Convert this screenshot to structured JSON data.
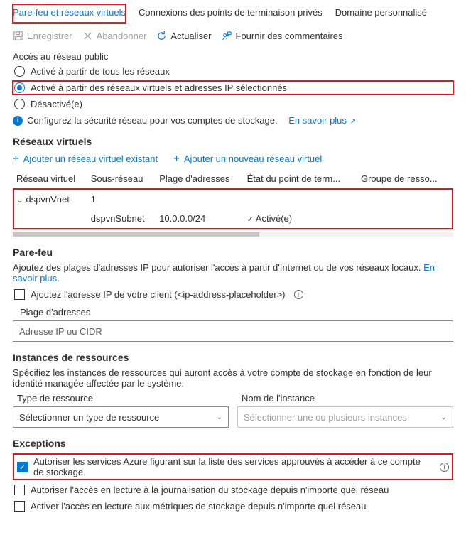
{
  "tabs": {
    "firewall": "Pare-feu et réseaux virtuels",
    "private": "Connexions des points de terminaison privés",
    "domain": "Domaine personnalisé"
  },
  "toolbar": {
    "save": "Enregistrer",
    "discard": "Abandonner",
    "refresh": "Actualiser",
    "feedback": "Fournir des commentaires"
  },
  "public_access": {
    "heading": "Accès au réseau public",
    "opt_all": "Activé à partir de tous les réseaux",
    "opt_selected": "Activé à partir des réseaux virtuels et adresses IP sélectionnés",
    "opt_disabled": "Désactivé(e)",
    "info": "Configurez la sécurité réseau pour vos comptes de stockage.",
    "learn_more": "En savoir plus"
  },
  "vnet": {
    "heading": "Réseaux virtuels",
    "add_existing": "Ajouter un réseau virtuel existant",
    "add_new": "Ajouter un nouveau réseau virtuel",
    "col_vnet": "Réseau virtuel",
    "col_subnet": "Sous-réseau",
    "col_range": "Plage d'adresses",
    "col_state": "État du point de term...",
    "col_rg": "Groupe de resso...",
    "row_vnet": "dspvnVnet",
    "row_count": "1",
    "row_subnet": "dspvnSubnet",
    "row_range": "10.0.0.0/24",
    "row_state": "Activé(e)"
  },
  "firewall": {
    "heading": "Pare-feu",
    "desc_pre": "Ajoutez des plages d'adresses IP pour autoriser l'accès à partir d'Internet ou de vos réseaux locaux. ",
    "desc_link": "En savoir plus.",
    "client_ip": "Ajoutez l'adresse IP de votre client (<ip-address-placeholder>)",
    "range_label": "Plage d'adresses",
    "placeholder": "Adresse IP ou CIDR"
  },
  "instances": {
    "heading": "Instances de ressources",
    "desc": "Spécifiez les instances de ressources qui auront accès à votre compte de stockage en fonction de leur identité managée affectée par le système.",
    "type_label": "Type de ressource",
    "name_label": "Nom de l'instance",
    "type_ph": "Sélectionner un type de ressource",
    "name_ph": "Sélectionner une ou plusieurs instances"
  },
  "exceptions": {
    "heading": "Exceptions",
    "trusted": "Autoriser les services Azure figurant sur la liste des services approuvés à accéder à ce compte de stockage.",
    "read_logs": "Autoriser l'accès en lecture à la journalisation du stockage depuis n'importe quel réseau",
    "read_metrics": "Activer l'accès en lecture aux métriques de stockage depuis n'importe quel réseau"
  }
}
